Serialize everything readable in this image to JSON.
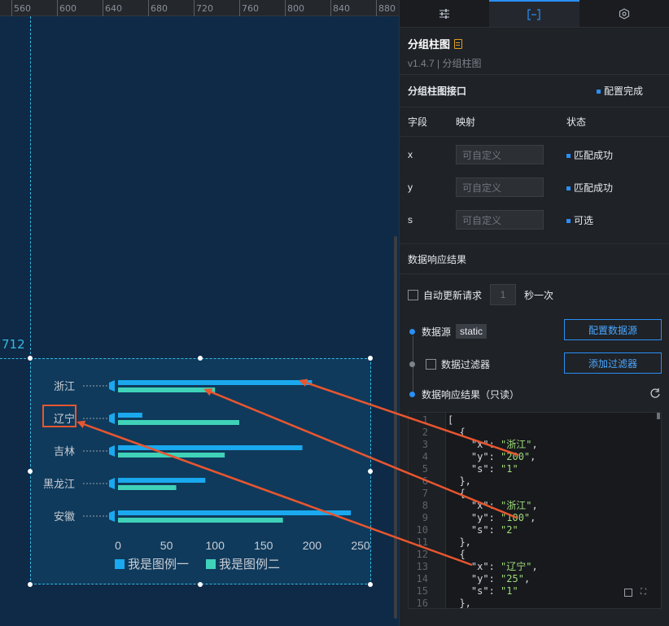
{
  "ruler": {
    "ticks": [
      "560",
      "600",
      "640",
      "680",
      "720",
      "760",
      "800",
      "840",
      "880"
    ]
  },
  "guide": {
    "label": "712"
  },
  "tabs": [
    {
      "name": "tab-style",
      "icon": "sliders-icon"
    },
    {
      "name": "tab-data",
      "icon": "data-bracket-icon"
    },
    {
      "name": "tab-interaction",
      "icon": "interaction-icon"
    }
  ],
  "component": {
    "title": "分组柱图",
    "version": "v1.4.7 | 分组柱图"
  },
  "interface": {
    "title": "分组柱图接口",
    "status": "配置完成"
  },
  "fields": {
    "headers": [
      "字段",
      "映射",
      "状态"
    ],
    "rows": [
      {
        "field": "x",
        "placeholder": "可自定义",
        "status": "匹配成功"
      },
      {
        "field": "y",
        "placeholder": "可自定义",
        "status": "匹配成功"
      },
      {
        "field": "s",
        "placeholder": "可自定义",
        "status": "可选"
      }
    ]
  },
  "response": {
    "title": "数据响应结果",
    "auto_update": "自动更新请求",
    "interval_value": "1",
    "interval_unit": "秒一次",
    "datasource_label": "数据源",
    "datasource_value": "static",
    "datasource_button": "配置数据源",
    "filter_label": "数据过滤器",
    "filter_button": "添加过滤器",
    "result_label": "数据响应结果（只读）"
  },
  "code_lines": [
    {
      "n": "1",
      "t": "["
    },
    {
      "n": "2",
      "t": "  {"
    },
    {
      "n": "3",
      "k": "    \"x\": ",
      "v": "\"浙江\"",
      "e": ","
    },
    {
      "n": "4",
      "k": "    \"y\": ",
      "v": "\"200\"",
      "e": ","
    },
    {
      "n": "5",
      "k": "    \"s\": ",
      "v": "\"1\"",
      "e": ""
    },
    {
      "n": "6",
      "t": "  },"
    },
    {
      "n": "7",
      "t": "  {"
    },
    {
      "n": "8",
      "k": "    \"x\": ",
      "v": "\"浙江\"",
      "e": ","
    },
    {
      "n": "9",
      "k": "    \"y\": ",
      "v": "\"100\"",
      "e": ","
    },
    {
      "n": "10",
      "k": "    \"s\": ",
      "v": "\"2\"",
      "e": ""
    },
    {
      "n": "11",
      "t": "  },"
    },
    {
      "n": "12",
      "t": "  {"
    },
    {
      "n": "13",
      "k": "    \"x\": ",
      "v": "\"辽宁\"",
      "e": ","
    },
    {
      "n": "14",
      "k": "    \"y\": ",
      "v": "\"25\"",
      "e": ","
    },
    {
      "n": "15",
      "k": "    \"s\": ",
      "v": "\"1\"",
      "e": ""
    },
    {
      "n": "16",
      "t": "  },"
    }
  ],
  "chart_data": {
    "type": "bar",
    "orientation": "horizontal",
    "categories": [
      "浙江",
      "辽宁",
      "吉林",
      "黑龙江",
      "安徽"
    ],
    "series": [
      {
        "name": "我是图例一",
        "color": "#1aa9ef",
        "values": [
          200,
          25,
          190,
          90,
          240
        ]
      },
      {
        "name": "我是图例二",
        "color": "#3fd2b8",
        "values": [
          100,
          125,
          110,
          60,
          170
        ]
      }
    ],
    "xticks": [
      0,
      50,
      100,
      150,
      200,
      250
    ],
    "xlim": [
      0,
      250
    ],
    "highlight_category": "辽宁"
  },
  "colors": {
    "accent": "#2a8ff7",
    "annotation": "#e8562f",
    "canvas_bg": "#0e2a47"
  }
}
